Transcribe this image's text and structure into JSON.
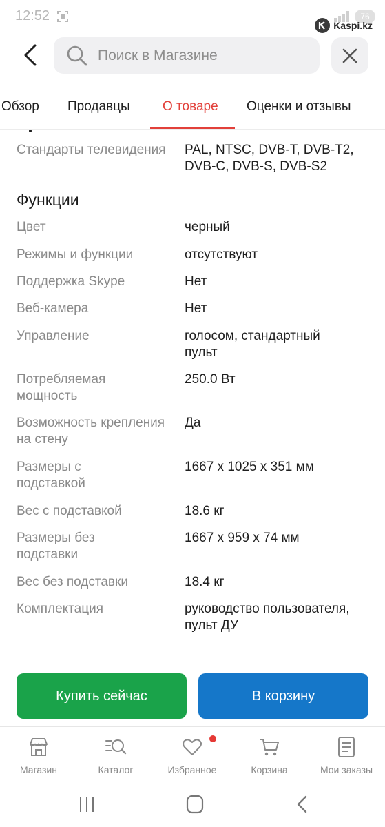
{
  "status_bar": {
    "time": "12:52",
    "battery": "76"
  },
  "watermark": {
    "text": "Kaspi.kz"
  },
  "search": {
    "placeholder": "Поиск в Магазине"
  },
  "tabs": [
    {
      "label": "Обзор",
      "active": false
    },
    {
      "label": "Продавцы",
      "active": false
    },
    {
      "label": "О товаре",
      "active": true
    },
    {
      "label": "Оценки и отзывы",
      "active": false
    }
  ],
  "specs": {
    "top_item": {
      "label": "Стандарты телевидения",
      "value": "PAL, NTSC, DVB-T, DVB-T2, DVB-C, DVB-S, DVB-S2"
    },
    "section_title": "Функции",
    "items": [
      {
        "label": "Цвет",
        "value": "черный"
      },
      {
        "label": "Режимы и функции",
        "value": "отсутствуют"
      },
      {
        "label": "Поддержка Skype",
        "value": "Нет"
      },
      {
        "label": "Веб-камера",
        "value": "Нет"
      },
      {
        "label": "Управление",
        "value": "голосом, стандартный пульт"
      },
      {
        "label": "Потребляемая мощность",
        "value": "250.0 Вт"
      },
      {
        "label": "Возможность крепления на стену",
        "value": "Да"
      },
      {
        "label": "Размеры с подставкой",
        "value": "1667 x 1025 x 351 мм"
      },
      {
        "label": "Вес с подставкой",
        "value": "18.6 кг"
      },
      {
        "label": "Размеры без подставки",
        "value": "1667 x 959 x 74 мм"
      },
      {
        "label": "Вес без подставки",
        "value": "18.4 кг"
      },
      {
        "label": "Комплектация",
        "value": "руководство пользователя, пульт ДУ"
      }
    ]
  },
  "actions": {
    "buy_now": "Купить сейчас",
    "add_to_cart": "В корзину"
  },
  "bottom_nav": [
    {
      "label": "Магазин",
      "icon": "store-icon"
    },
    {
      "label": "Каталог",
      "icon": "catalog-search-icon"
    },
    {
      "label": "Избранное",
      "icon": "heart-icon",
      "has_badge": true
    },
    {
      "label": "Корзина",
      "icon": "cart-icon"
    },
    {
      "label": "Мои заказы",
      "icon": "orders-icon"
    }
  ],
  "colors": {
    "accent": "#e2403a",
    "buy_now": "#1aa34a",
    "add_to_cart": "#1577c9",
    "label_gray": "#8a8a8a"
  }
}
